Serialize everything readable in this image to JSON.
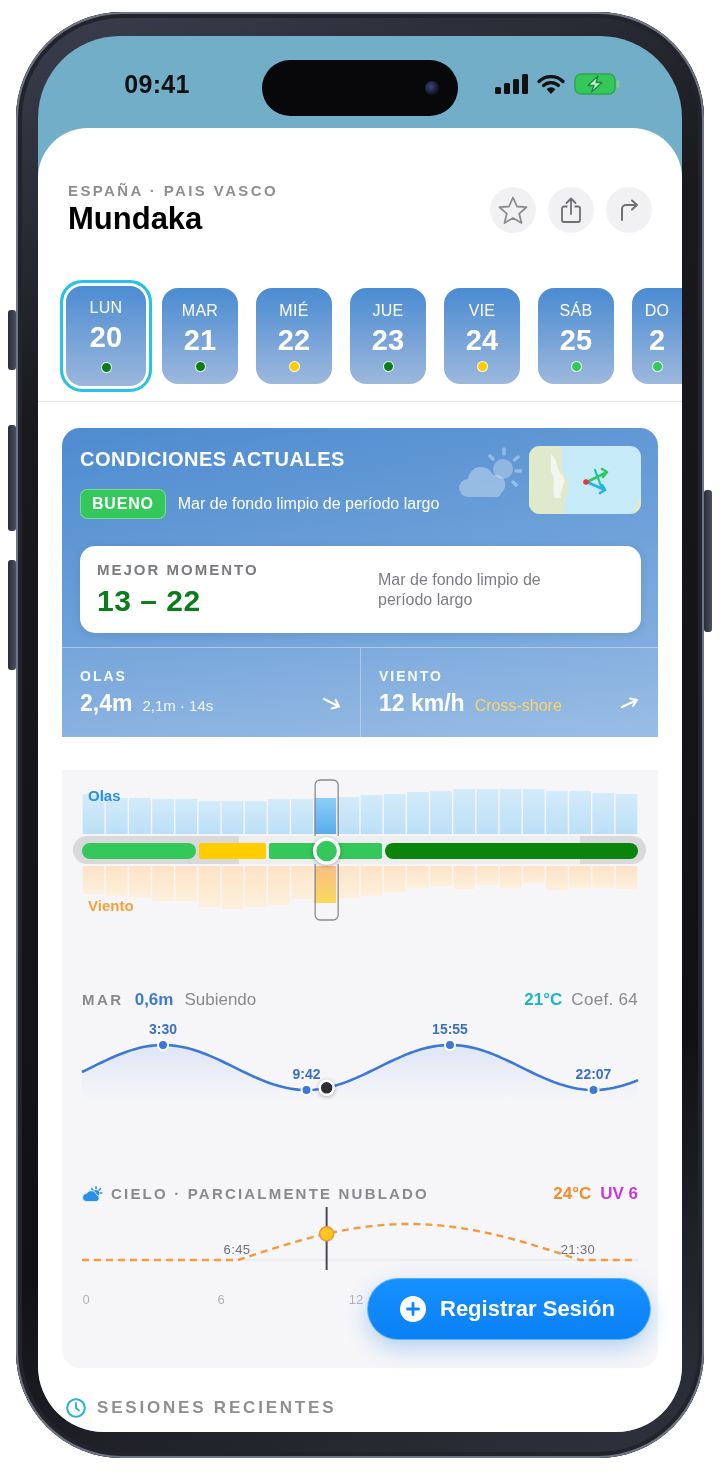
{
  "status_bar": {
    "time": "09:41"
  },
  "header": {
    "region": "ESPAÑA · PAIS VASCO",
    "spot": "Mundaka"
  },
  "days": [
    {
      "day": "LUN",
      "date": "20",
      "color": "#0a7d1a",
      "selected": true
    },
    {
      "day": "MAR",
      "date": "21",
      "color": "#0a7d1a",
      "selected": false
    },
    {
      "day": "MIÉ",
      "date": "22",
      "color": "#ffcc00",
      "selected": false
    },
    {
      "day": "JUE",
      "date": "23",
      "color": "#0a7d1a",
      "selected": false
    },
    {
      "day": "VIE",
      "date": "24",
      "color": "#ffcc00",
      "selected": false
    },
    {
      "day": "SÁB",
      "date": "25",
      "color": "#34c759",
      "selected": false
    },
    {
      "day": "DO",
      "date": "2",
      "color": "#34c759",
      "selected": false
    }
  ],
  "conditions": {
    "title": "CONDICIONES ACTUALES",
    "rating": "BUENO",
    "summary": "Mar de fondo limpio de período largo",
    "best_time": {
      "label": "MEJOR MOMENTO",
      "value": "13 – 22",
      "note": "Mar de fondo limpio de período largo"
    },
    "waves": {
      "label": "OLAS",
      "value": "2,4m",
      "detail": "2,1m · 14s"
    },
    "wind": {
      "label": "VIENTO",
      "value": "12 km/h",
      "detail": "Cross-shore"
    }
  },
  "timeline": {
    "waves_label": "Olas",
    "wind_label": "Viento",
    "level": 0.44
  },
  "tide": {
    "label": "MAR",
    "height": "0,6m",
    "trend": "Subiendo",
    "water_temp": "21°C",
    "coefficient": "Coef. 64",
    "points": [
      {
        "time": "3:30",
        "kind": "high"
      },
      {
        "time": "9:42",
        "kind": "low"
      },
      {
        "time": "15:55",
        "kind": "high"
      },
      {
        "time": "22:07",
        "kind": "low"
      }
    ]
  },
  "sky": {
    "title": "CIELO · PARCIALMENTE NUBLADO",
    "temperature": "24°C",
    "uv": "UV 6",
    "sunrise": "6:45",
    "sunset": "21:30",
    "hours": [
      "0",
      "6",
      "12"
    ]
  },
  "action_button": {
    "label": "Registrar Sesión"
  },
  "recent_sessions": {
    "title": "SESIONES RECIENTES"
  }
}
